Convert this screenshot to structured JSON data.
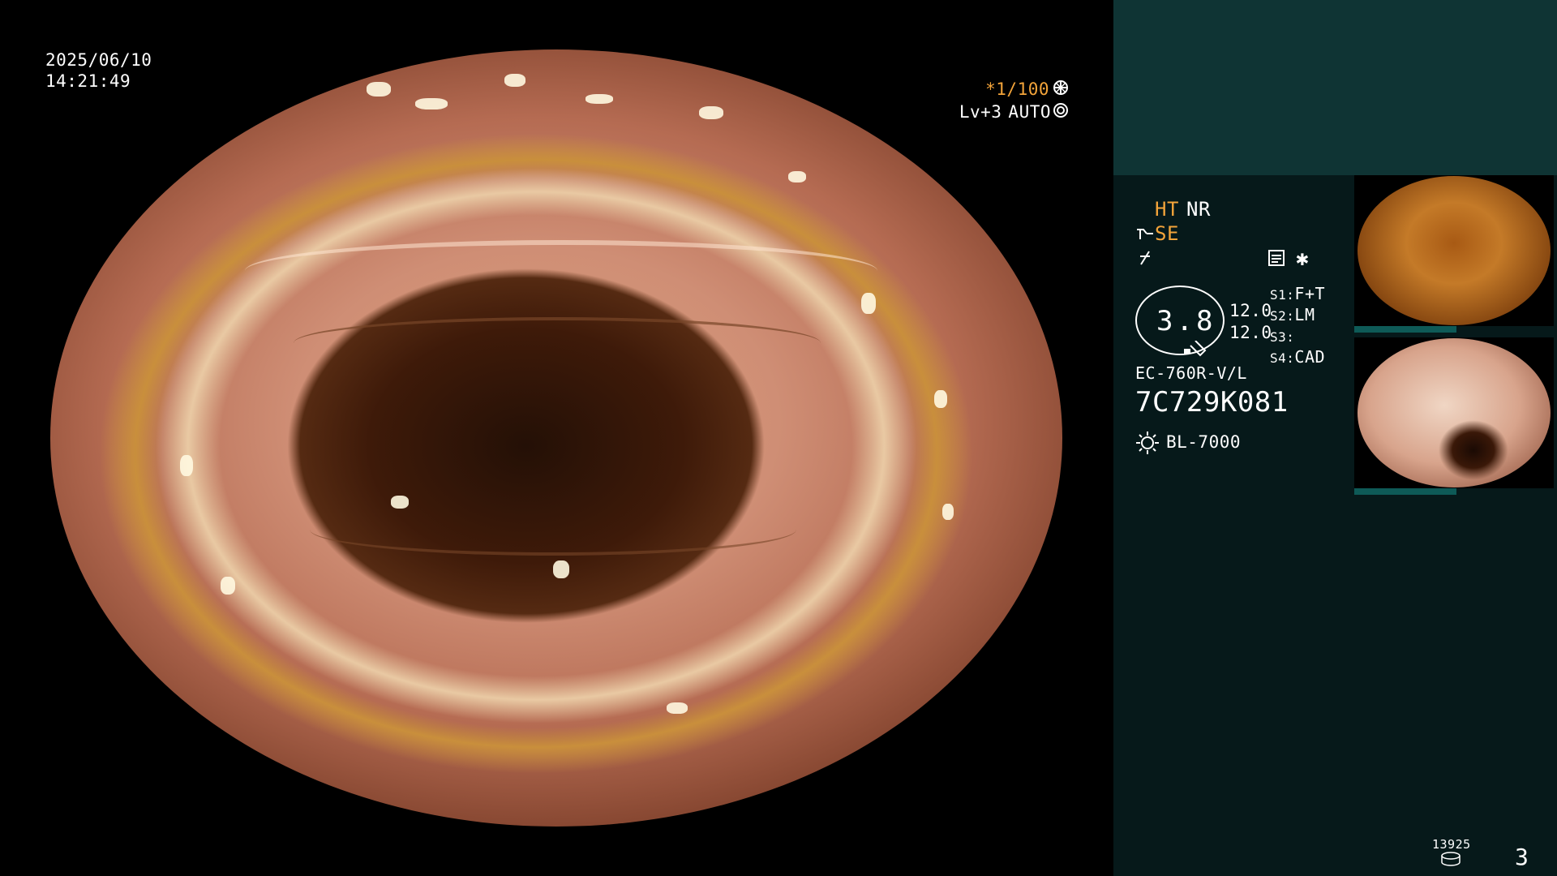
{
  "overlay": {
    "date": "2025/06/10",
    "time": "14:21:49",
    "shutter": "*1/100",
    "level": "Lv+3",
    "mode": "AUTO"
  },
  "settings": {
    "ht_label": "HT",
    "nr_label": "NR",
    "se_label": "SE",
    "zoom_value": "3.8",
    "value_1": "12.0",
    "value_2": "12.0",
    "s1_label": "S1:",
    "s1_value": "F+T",
    "s2_label": "S2:",
    "s2_value": "LM",
    "s3_label": "S3:",
    "s3_value": "",
    "s4_label": "S4:",
    "s4_value": "CAD",
    "scope_model": "EC-760R-V/L",
    "scope_serial": "7C729K081",
    "light_source": "BL-7000"
  },
  "storage": {
    "count": "13925",
    "page_number": "3"
  },
  "icons": [
    "wheel-icon",
    "iris-icon",
    "enhance-icon",
    "structure-icon",
    "memo-icon",
    "asterisk-icon",
    "light-icon",
    "disk-icon"
  ],
  "colors": {
    "accent_orange": "#f3a43a",
    "panel_dark": "#06191a",
    "panel_top": "#0f3434"
  }
}
